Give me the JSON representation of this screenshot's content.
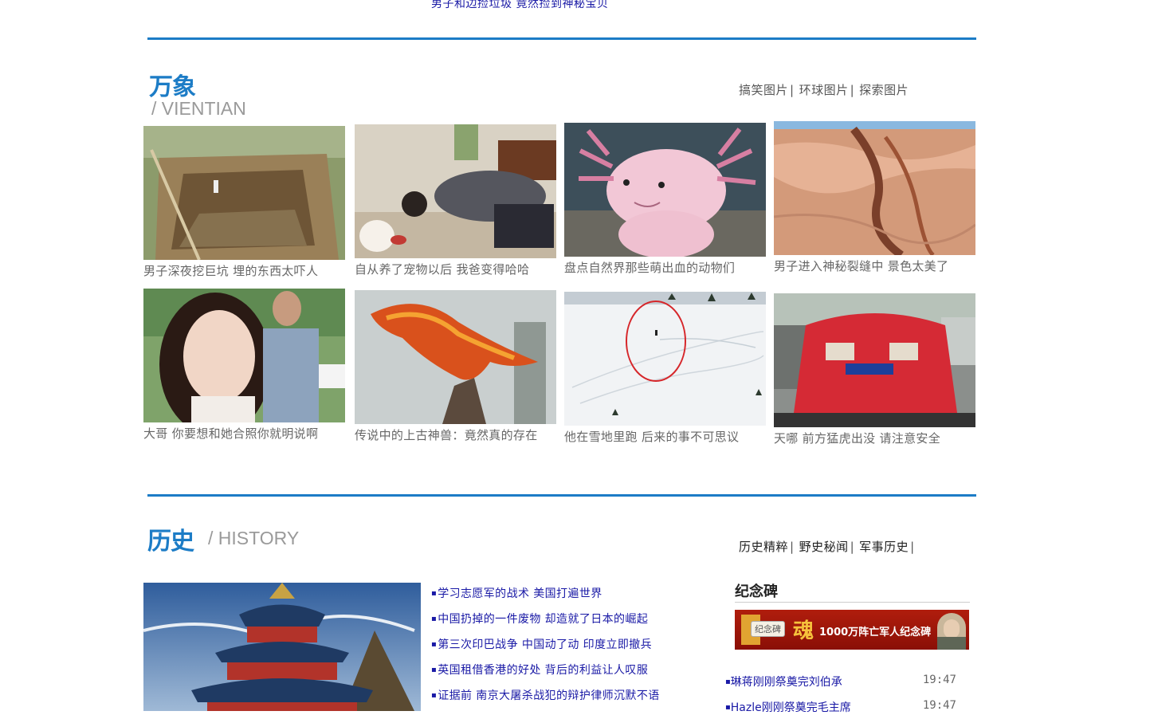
{
  "top_headline": "男子和边捡垃圾 竟然捡到神秘宝贝",
  "vientian": {
    "title": "万象",
    "subtitle": "/ VIENTIAN",
    "links": [
      "搞笑图片",
      "环球图片",
      "探索图片"
    ],
    "items": [
      {
        "caption": "男子深夜挖巨坑 埋的东西太吓人",
        "image": "dirt-pit-photo"
      },
      {
        "caption": "自从养了宠物以后 我爸变得哈哈",
        "image": "man-with-puppy-photo"
      },
      {
        "caption": "盘点自然界那些萌出血的动物们",
        "image": "axolotl-photo"
      },
      {
        "caption": "男子进入神秘裂缝中 景色太美了",
        "image": "canyon-crevice-photo"
      },
      {
        "caption": "大哥 你要想和她合照你就明说啊",
        "image": "selfie-photobomb-photo"
      },
      {
        "caption": "传说中的上古神兽：竟然真的存在",
        "image": "fire-dragon-photo"
      },
      {
        "caption": "他在雪地里跑 后来的事不可思议",
        "image": "snow-field-photo"
      },
      {
        "caption": "天哪 前方猛虎出没 请注意安全",
        "image": "red-car-photo"
      }
    ]
  },
  "history": {
    "title": "历史",
    "subtitle": "/ HISTORY",
    "links": [
      "历史精粹",
      "野史秘闻",
      "军事历史"
    ],
    "articles": [
      "学习志愿军的战术 美国打遍世界",
      "中国扔掉的一件废物 却造就了日本的崛起",
      "第三次印巴战争 中国动了动 印度立即撤兵",
      "英国租借香港的好处 背后的利益让人叹服",
      "证据前 南京大屠杀战犯的辩护律师沉默不语"
    ],
    "memorial": {
      "title": "纪念碑",
      "banner_tag": "纪念碑",
      "banner_char": "魂",
      "banner_text": "1000万阵亡军人纪念碑",
      "news": [
        {
          "text": "琳蒋刚刚祭奠完刘伯承",
          "time": "19:47"
        },
        {
          "text": "Hazle刚刚祭奠完毛主席",
          "time": "19:47"
        }
      ]
    }
  },
  "colors": {
    "accent": "#1c7cc6",
    "link": "#1a1aa6",
    "banner_red": "#a0150a"
  }
}
